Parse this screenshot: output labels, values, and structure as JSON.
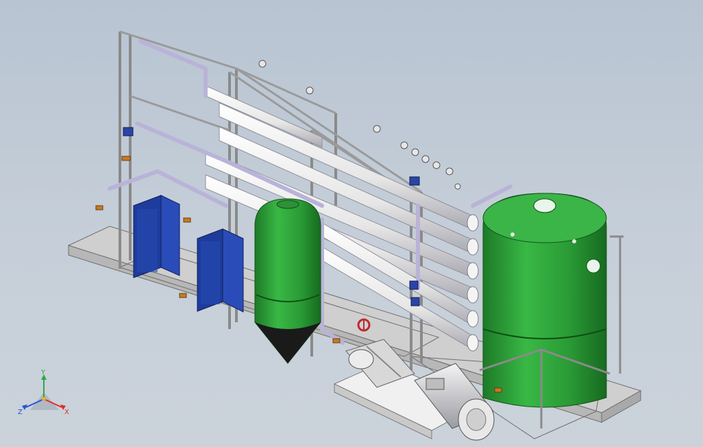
{
  "viewport": {
    "background_top": "#b8c4d2",
    "background_bottom": "#cbd2da"
  },
  "model": {
    "equipment": "reverse-osmosis-water-treatment-skid",
    "frame_color": "#d9d9d9",
    "tank_color": "#2fa83a",
    "tank_shade": "#1f7a28",
    "pipe_color": "#f2f2f2",
    "heat_exchanger_color": "#1f3fa0",
    "valve_color": "#c0282e",
    "fitting_color": "#c77a22"
  },
  "triad": {
    "x_label": "X",
    "y_label": "Y",
    "z_label": "Z",
    "x_color": "#d8302c",
    "y_color": "#2ea64a",
    "z_color": "#2c4fd8"
  }
}
